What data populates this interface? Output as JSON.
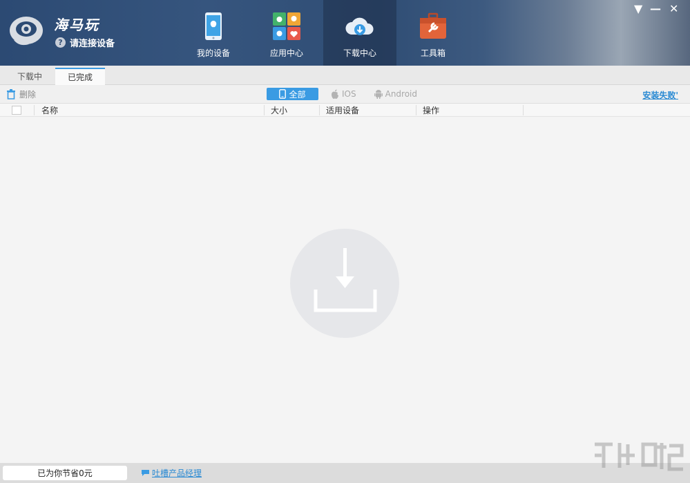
{
  "app": {
    "brand": "海马玩",
    "connect_text": "请连接设备",
    "help_glyph": "?"
  },
  "nav": [
    {
      "label": "我的设备",
      "icon": "phone-icon"
    },
    {
      "label": "应用中心",
      "icon": "apps-grid-icon"
    },
    {
      "label": "下载中心",
      "icon": "cloud-download-icon",
      "active": true
    },
    {
      "label": "工具箱",
      "icon": "toolbox-icon"
    }
  ],
  "window": {
    "menu_glyph": "▼",
    "minimize_glyph": "—",
    "close_glyph": "✕"
  },
  "tabs": [
    {
      "label": "下载中"
    },
    {
      "label": "已完成",
      "active": true
    }
  ],
  "toolbar": {
    "delete_label": "删除",
    "filters": [
      {
        "label": "全部",
        "icon": "phone-icon",
        "active": true
      },
      {
        "label": "IOS",
        "icon": "apple-icon"
      },
      {
        "label": "Android",
        "icon": "android-icon"
      }
    ],
    "install_fail": "安装失败'"
  },
  "table": {
    "columns": [
      "名称",
      "大小",
      "适用设备",
      "操作"
    ]
  },
  "footer": {
    "saved_text": "已为你节省0元",
    "feedback_link": "吐槽产品经理"
  },
  "colors": {
    "accent": "#3a9be3",
    "link": "#2a8ad3",
    "header": "#2f4d74"
  }
}
